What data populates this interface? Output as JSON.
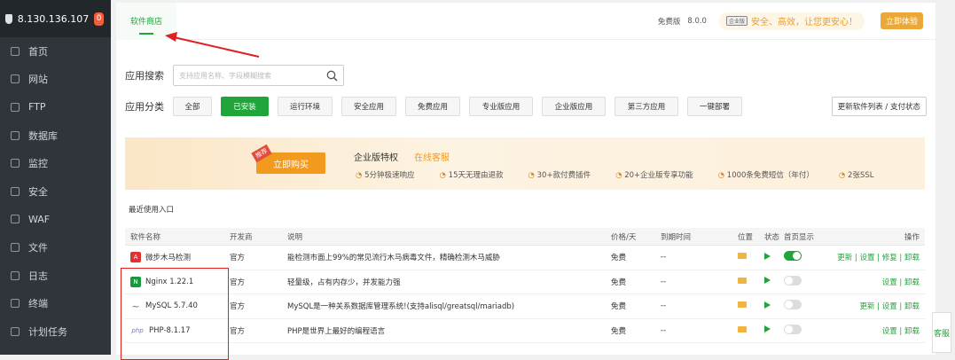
{
  "sidebar": {
    "ip": "8.130.136.107",
    "badge": "0",
    "items": [
      {
        "label": "首页",
        "icon": "home-icon"
      },
      {
        "label": "网站",
        "icon": "globe-icon"
      },
      {
        "label": "FTP",
        "icon": "ftp-icon"
      },
      {
        "label": "数据库",
        "icon": "database-icon"
      },
      {
        "label": "监控",
        "icon": "monitor-icon"
      },
      {
        "label": "安全",
        "icon": "shield-icon"
      },
      {
        "label": "WAF",
        "icon": "waf-shield-icon"
      },
      {
        "label": "文件",
        "icon": "folder-icon"
      },
      {
        "label": "日志",
        "icon": "log-icon"
      },
      {
        "label": "终端",
        "icon": "terminal-icon"
      },
      {
        "label": "计划任务",
        "icon": "calendar-icon"
      }
    ]
  },
  "topbar": {
    "tab": "软件商店",
    "edition": "免费版",
    "version": "8.0.0",
    "ent_icon": "企业版",
    "ent_slogan": "安全、高效，让您更安心！",
    "try_btn": "立即体验"
  },
  "search": {
    "label": "应用搜索",
    "placeholder": "支持应用名称、字段模糊搜索"
  },
  "category": {
    "label": "应用分类",
    "items": [
      "全部",
      "已安装",
      "运行环境",
      "安全应用",
      "免费应用",
      "专业版应用",
      "企业版应用",
      "第三方应用",
      "一键部署"
    ],
    "update_btn": "更新软件列表 / 支付状态"
  },
  "banner": {
    "tag": "推荐",
    "buy": "立即购买",
    "title": "企业版特权",
    "service": "在线客服",
    "features": [
      "5分钟极速响应",
      "15天无理由退款",
      "30+款付费插件",
      "20+企业版专享功能",
      "1000条免费短信（年付）",
      "2张SSL"
    ]
  },
  "recent": "最近使用入口",
  "table": {
    "headers": [
      "软件名称",
      "开发商",
      "说明",
      "价格/天",
      "到期时间",
      "位置",
      "状态",
      "首页显示",
      "操作"
    ],
    "rows": [
      {
        "name": "微步木马检测",
        "dev": "官方",
        "desc": "能检测市面上99%的常见流行木马病毒文件，精确检测木马威胁",
        "price": "免费",
        "exp": "--",
        "home": true,
        "ops": "更新 | 设置 | 修复 | 卸载",
        "icon": "A",
        "color": "#d33"
      },
      {
        "name": "Nginx 1.22.1",
        "dev": "官方",
        "desc": "轻量级，占有内存少，并发能力强",
        "price": "免费",
        "exp": "--",
        "home": false,
        "ops": "设置 | 卸载",
        "icon": "N",
        "color": "#159a3e"
      },
      {
        "name": "MySQL 5.7.40",
        "dev": "官方",
        "desc": "MySQL是一种关系数据库管理系统!(支持alisql/greatsql/mariadb)",
        "price": "免费",
        "exp": "--",
        "home": false,
        "ops": "更新 | 设置 | 卸载",
        "icon": "~",
        "color": "#4a6fa5"
      },
      {
        "name": "PHP-8.1.17",
        "dev": "官方",
        "desc": "PHP是世界上最好的编程语言",
        "price": "免费",
        "exp": "--",
        "home": false,
        "ops": "设置 | 卸载",
        "icon": "php",
        "color": "#6d7bb5"
      }
    ]
  },
  "kefu": "客服"
}
